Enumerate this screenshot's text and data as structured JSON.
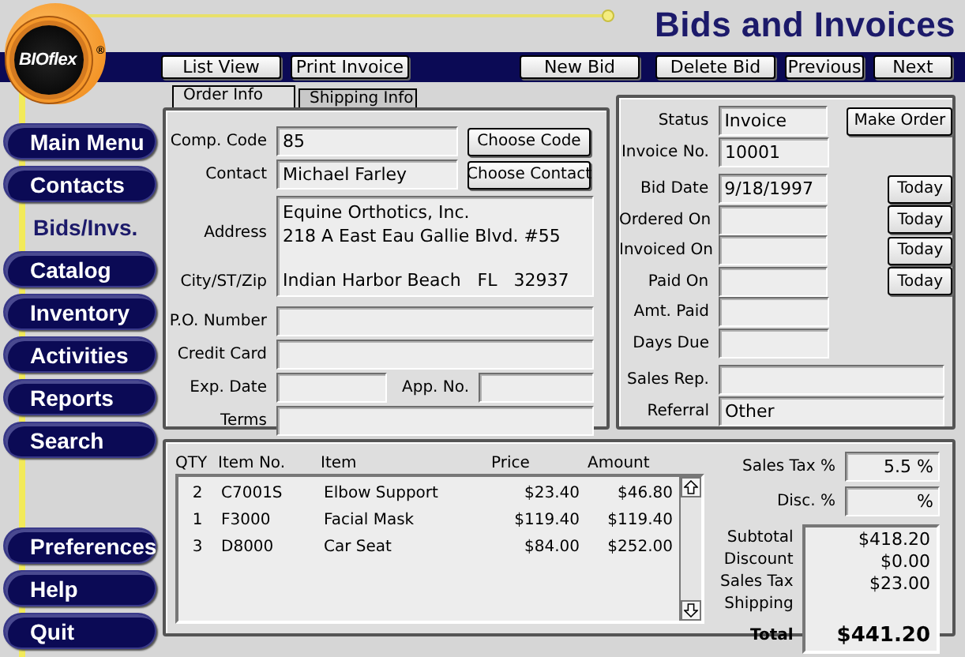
{
  "app": {
    "logo": "BIOflex",
    "logo_mark": "®",
    "title": "Bids and Invoices"
  },
  "toolbar": {
    "left": [
      "List View",
      "Print Invoice"
    ],
    "right": [
      "New Bid",
      "Delete Bid",
      "Previous",
      "Next"
    ]
  },
  "nav": {
    "top": [
      {
        "label": "Main Menu",
        "selected": false
      },
      {
        "label": "Contacts",
        "selected": false
      },
      {
        "label": "Bids/Invs.",
        "selected": true
      },
      {
        "label": "Catalog",
        "selected": false
      },
      {
        "label": "Inventory",
        "selected": false
      },
      {
        "label": "Activities",
        "selected": false
      },
      {
        "label": "Reports",
        "selected": false
      },
      {
        "label": "Search",
        "selected": false
      }
    ],
    "bottom": [
      {
        "label": "Preferences",
        "selected": false
      },
      {
        "label": "Help",
        "selected": false
      },
      {
        "label": "Quit",
        "selected": false
      }
    ]
  },
  "tabs": [
    {
      "label": "Order Info",
      "selected": true
    },
    {
      "label": "Shipping Info",
      "selected": false
    }
  ],
  "order_info": {
    "comp_code": {
      "label": "Comp. Code",
      "value": "85",
      "button": "Choose Code"
    },
    "contact": {
      "label": "Contact",
      "value": "Michael Farley",
      "button": "Choose Contact"
    },
    "address": {
      "label": "Address",
      "lines": [
        "Equine Orthotics, Inc.",
        "218 A East Eau Gallie Blvd. #55"
      ]
    },
    "city": {
      "label": "City/ST/Zip",
      "value": "Indian Harbor Beach   FL   32937"
    },
    "po_number": {
      "label": "P.O. Number"
    },
    "credit_card": {
      "label": "Credit Card"
    },
    "exp_date": {
      "label": "Exp. Date"
    },
    "app_no": {
      "label": "App. No."
    },
    "terms": {
      "label": "Terms"
    }
  },
  "status_panel": [
    {
      "kind": "short",
      "label": "Status",
      "value": "Invoice",
      "button": "Make Order"
    },
    {
      "kind": "short",
      "label": "Invoice No.",
      "value": "10001"
    },
    {
      "kind": "short",
      "label": "Bid Date",
      "value": "9/18/1997",
      "button": "Today"
    },
    {
      "kind": "short",
      "label": "Ordered On",
      "button": "Today"
    },
    {
      "kind": "short",
      "label": "Invoiced On",
      "button": "Today"
    },
    {
      "kind": "short",
      "label": "Paid On",
      "button": "Today"
    },
    {
      "kind": "short",
      "label": "Amt. Paid"
    },
    {
      "kind": "short",
      "label": "Days Due"
    },
    {
      "kind": "wide",
      "label": "Sales Rep."
    },
    {
      "kind": "wide",
      "label": "Referral",
      "value": "Other"
    }
  ],
  "line_items": {
    "columns": [
      "QTY",
      "Item No.",
      "Item",
      "Price",
      "Amount"
    ],
    "rows": [
      [
        "2",
        "C7001S",
        "Elbow Support",
        "$23.40",
        "$46.80"
      ],
      [
        "1",
        "F3000",
        "Facial Mask",
        "$119.40",
        "$119.40"
      ],
      [
        "3",
        "D8000",
        "Car Seat",
        "$84.00",
        "$252.00"
      ]
    ]
  },
  "rates": [
    {
      "label": "Sales Tax %",
      "value": "5.5 %"
    },
    {
      "label": "Disc. %",
      "value": "%"
    }
  ],
  "totals": [
    {
      "label": "Subtotal",
      "value": "$418.20",
      "bold": false
    },
    {
      "label": "Discount",
      "value": "$0.00",
      "bold": false
    },
    {
      "label": "Sales Tax",
      "value": "$23.00",
      "bold": false
    },
    {
      "label": "Shipping",
      "bold": false
    },
    {
      "label": "Total",
      "value": "$441.20",
      "bold": true
    }
  ]
}
